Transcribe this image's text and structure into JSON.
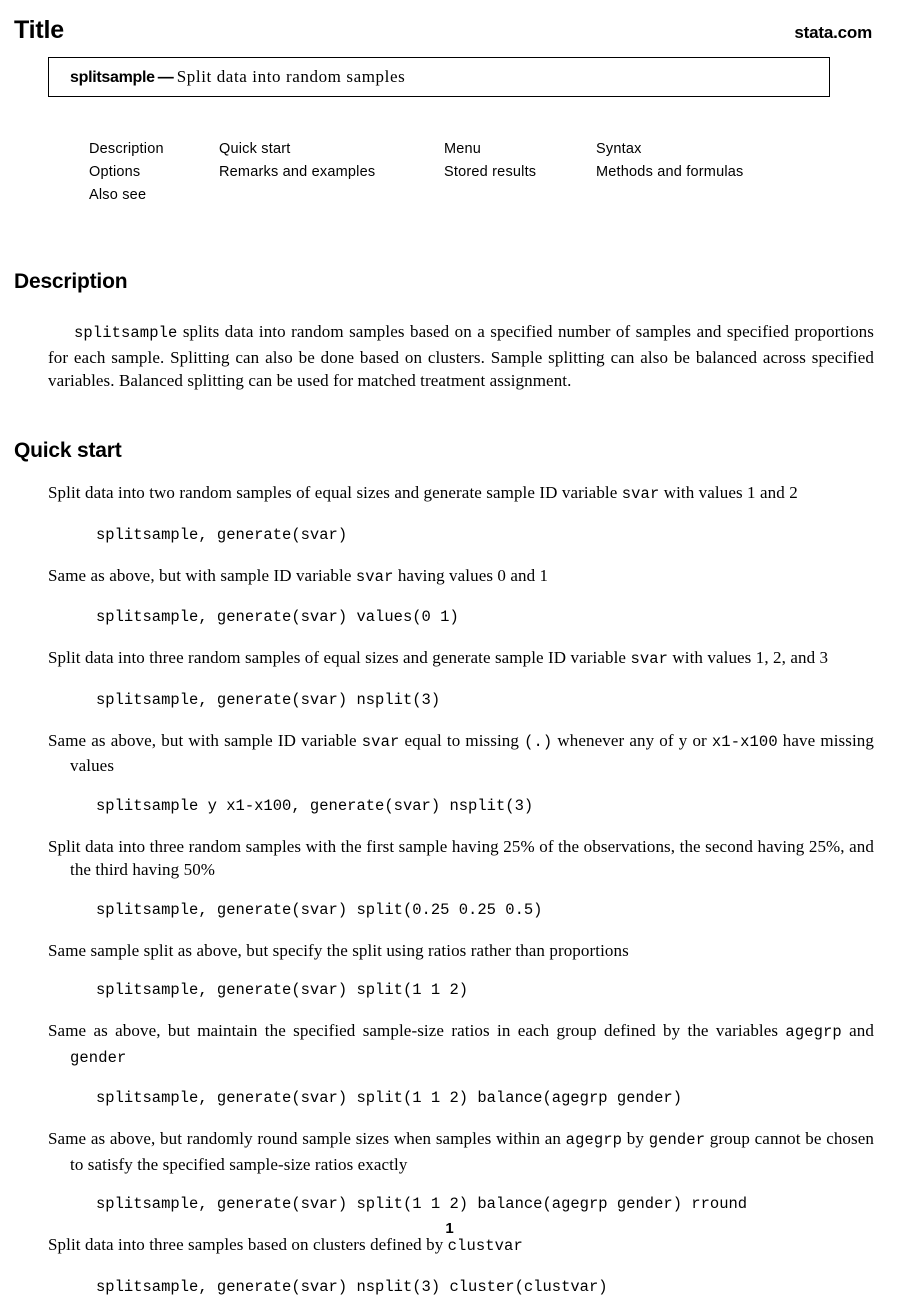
{
  "header": {
    "title": "Title",
    "site": "stata.com"
  },
  "title_box": {
    "command": "splitsample",
    "dash": "—",
    "description": "Split data into random samples"
  },
  "nav_links": {
    "columns": [
      {
        "items": [
          "Description",
          "Options",
          "Also see"
        ]
      },
      {
        "items": [
          "Quick start",
          "Remarks and examples"
        ]
      },
      {
        "items": [
          "Menu",
          "Stored results"
        ]
      },
      {
        "items": [
          "Syntax",
          "Methods and formulas"
        ]
      }
    ]
  },
  "sections": {
    "description": {
      "heading": "Description",
      "body_code": "splitsample",
      "body_rest": " splits data into random samples based on a specified number of samples and specified proportions for each sample. Splitting can also be done based on clusters. Sample splitting can also be balanced across specified variables. Balanced splitting can be used for matched treatment assignment."
    },
    "quick_start": {
      "heading": "Quick start",
      "entries": [
        {
          "text_parts": [
            {
              "type": "text",
              "value": "Split data into two random samples of equal sizes and generate sample ID variable "
            },
            {
              "type": "code",
              "value": "svar"
            },
            {
              "type": "text",
              "value": " with values 1 and 2"
            }
          ],
          "code": "splitsample, generate(svar)",
          "justify": true
        },
        {
          "text_parts": [
            {
              "type": "text",
              "value": "Same as above, but with sample ID variable "
            },
            {
              "type": "code",
              "value": "svar"
            },
            {
              "type": "text",
              "value": " having values 0 and 1"
            }
          ],
          "code": "splitsample, generate(svar) values(0 1)",
          "justify": false
        },
        {
          "text_parts": [
            {
              "type": "text",
              "value": "Split data into three random samples of equal sizes and generate sample ID variable "
            },
            {
              "type": "code",
              "value": "svar"
            },
            {
              "type": "text",
              "value": " with values 1, 2, and 3"
            }
          ],
          "code": "splitsample, generate(svar) nsplit(3)",
          "justify": true
        },
        {
          "text_parts": [
            {
              "type": "text",
              "value": "Same as above, but with sample ID variable "
            },
            {
              "type": "code",
              "value": "svar"
            },
            {
              "type": "text",
              "value": " equal to missing "
            },
            {
              "type": "code",
              "value": "(.)"
            },
            {
              "type": "text",
              "value": " whenever any of y or "
            },
            {
              "type": "code",
              "value": "x1-x100"
            },
            {
              "type": "text",
              "value": " have missing values"
            }
          ],
          "code": "splitsample y x1-x100, generate(svar) nsplit(3)",
          "justify": true
        },
        {
          "text_parts": [
            {
              "type": "text",
              "value": "Split data into three random samples with the first sample having 25% of the observations, the second having 25%, and the third having 50%"
            }
          ],
          "code": "splitsample, generate(svar) split(0.25 0.25 0.5)",
          "justify": true
        },
        {
          "text_parts": [
            {
              "type": "text",
              "value": "Same sample split as above, but specify the split using ratios rather than proportions"
            }
          ],
          "code": "splitsample, generate(svar) split(1 1 2)",
          "justify": false
        },
        {
          "text_parts": [
            {
              "type": "text",
              "value": "Same as above, but maintain the specified sample-size ratios in each group defined by the variables "
            },
            {
              "type": "code",
              "value": "agegrp"
            },
            {
              "type": "text",
              "value": " and "
            },
            {
              "type": "code",
              "value": "gender"
            }
          ],
          "code": "splitsample, generate(svar) split(1 1 2) balance(agegrp gender)",
          "justify": true
        },
        {
          "text_parts": [
            {
              "type": "text",
              "value": "Same as above, but randomly round sample sizes when samples within an "
            },
            {
              "type": "code",
              "value": "agegrp"
            },
            {
              "type": "text",
              "value": " by "
            },
            {
              "type": "code",
              "value": "gender"
            },
            {
              "type": "text",
              "value": " group cannot be chosen to satisfy the specified sample-size ratios exactly"
            }
          ],
          "code": "splitsample, generate(svar) split(1 1 2) balance(agegrp gender) rround",
          "justify": true
        },
        {
          "text_parts": [
            {
              "type": "text",
              "value": "Split data into three samples based on clusters defined by "
            },
            {
              "type": "code",
              "value": "clustvar"
            }
          ],
          "code": "splitsample, generate(svar) nsplit(3) cluster(clustvar)",
          "justify": false
        }
      ]
    }
  },
  "footer": {
    "page_number": "1"
  }
}
